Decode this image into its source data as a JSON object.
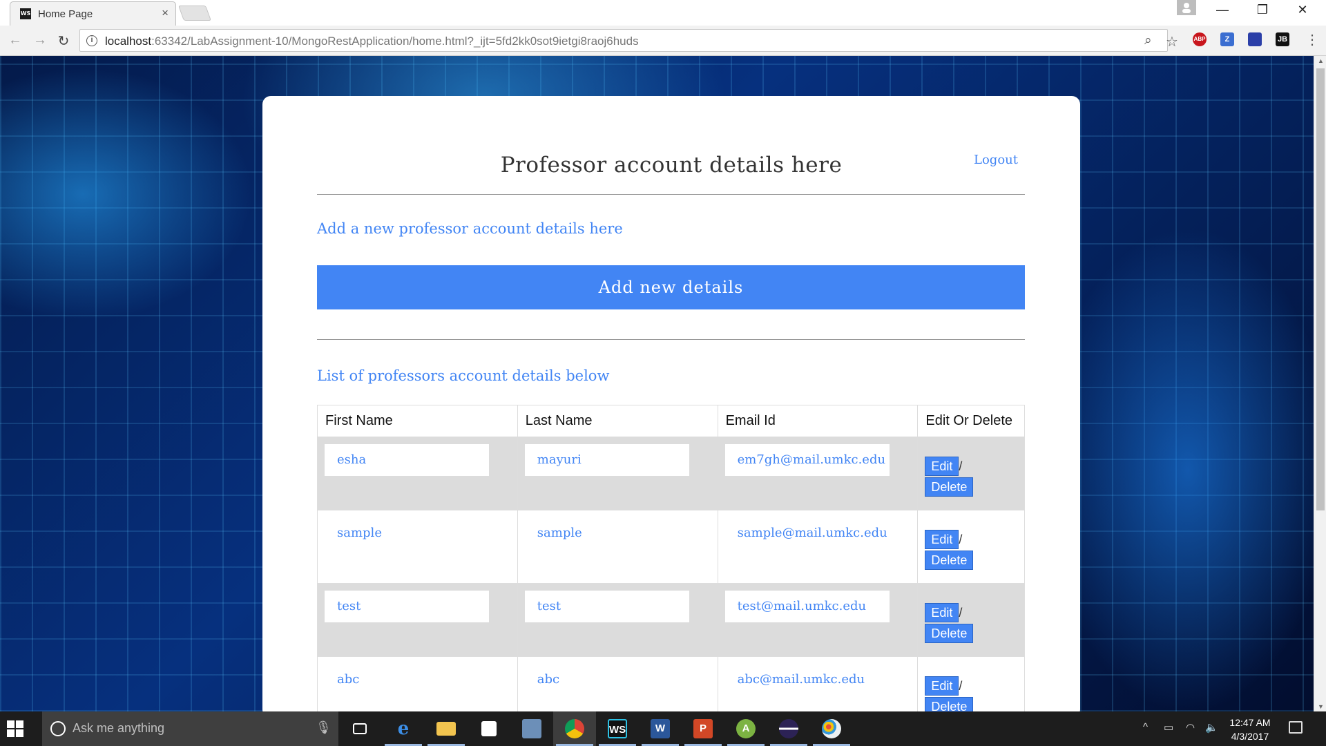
{
  "browser": {
    "tab_title": "Home Page",
    "tab_close": "×",
    "url_host": "localhost",
    "url_path": ":63342/LabAssignment-10/MongoRestApplication/home.html?_ijt=5fd2kk0sot9ietgi8raoj6huds",
    "back": "←",
    "forward": "→",
    "reload": "↻",
    "zoom_icon": "⌕",
    "star_icon": "☆",
    "extensions": [
      "ABP",
      "Z",
      "",
      "JB"
    ],
    "menu": "⋮",
    "window_controls": [
      "—",
      "❐",
      "✕"
    ]
  },
  "page": {
    "title": "Professor account details here",
    "logout": "Logout",
    "add_heading": "Add a new professor account details here",
    "add_button": "Add new details",
    "list_heading": "List of professors account details below",
    "table": {
      "headers": [
        "First Name",
        "Last Name",
        "Email Id",
        "Edit Or Delete"
      ],
      "rows": [
        {
          "first": "esha",
          "last": "mayuri",
          "email": "em7gh@mail.umkc.edu",
          "shaded": true
        },
        {
          "first": "sample",
          "last": "sample",
          "email": "sample@mail.umkc.edu",
          "shaded": false
        },
        {
          "first": "test",
          "last": "test",
          "email": "test@mail.umkc.edu",
          "shaded": true
        },
        {
          "first": "abc",
          "last": "abc",
          "email": "abc@mail.umkc.edu",
          "shaded": false
        }
      ],
      "edit_label": "Edit",
      "delete_label": "Delete",
      "separator": "/"
    }
  },
  "taskbar": {
    "search_placeholder": "Ask me anything",
    "time": "12:47 AM",
    "date": "4/3/2017"
  }
}
